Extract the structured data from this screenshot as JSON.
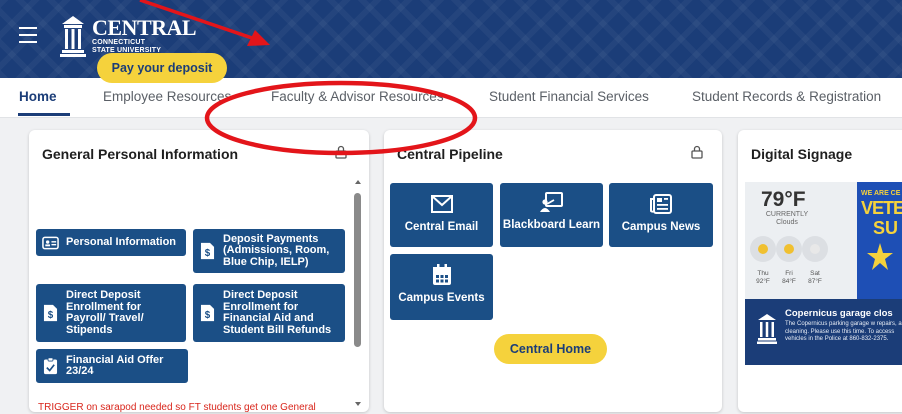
{
  "header": {
    "logo_title": "CENTRAL",
    "logo_line1": "CONNECTICUT",
    "logo_line2": "STATE UNIVERSITY"
  },
  "nav": {
    "tabs": [
      {
        "label": "Home",
        "active": true
      },
      {
        "label": "Employee Resources",
        "active": false
      },
      {
        "label": "Faculty & Advisor Resources",
        "active": false
      },
      {
        "label": "Student Financial Services",
        "active": false
      },
      {
        "label": "Student Records & Registration",
        "active": false
      }
    ]
  },
  "general": {
    "title": "General Personal Information",
    "pay_button": "Pay your deposit",
    "buttons": [
      {
        "label": "Personal Information",
        "icon": "id-card-icon"
      },
      {
        "label": "Deposit Payments (Admissions, Room, Blue Chip, IELP)",
        "icon": "dollar-doc-icon"
      },
      {
        "label": "Direct Deposit Enrollment for Payroll/ Travel/ Stipends",
        "icon": "dollar-doc-icon"
      },
      {
        "label": "Direct Deposit Enrollment for Financial Aid and Student Bill Refunds",
        "icon": "dollar-doc-icon"
      },
      {
        "label": "Financial Aid Offer 23/24",
        "icon": "checklist-icon"
      }
    ],
    "trigger_text": "TRIGGER on sarapod needed so FT students get one General"
  },
  "pipeline": {
    "title": "Central Pipeline",
    "buttons": [
      {
        "label": "Central Email",
        "icon": "envelope-icon"
      },
      {
        "label": "Blackboard Learn",
        "icon": "presentation-icon"
      },
      {
        "label": "Campus News",
        "icon": "newspaper-icon"
      },
      {
        "label": "Campus Events",
        "icon": "calendar-icon"
      }
    ],
    "home_button": "Central Home"
  },
  "signage": {
    "title": "Digital Signage",
    "temp": "79°F",
    "current": "CURRENTLY",
    "conditions": "Clouds",
    "forecast": [
      {
        "day": "Thu",
        "temp": "92°F"
      },
      {
        "day": "Fri",
        "temp": "84°F"
      },
      {
        "day": "Sat",
        "temp": "87°F"
      }
    ],
    "vet_small": "WE ARE CE",
    "vet_big": "VETE",
    "vet_big2": "SU",
    "notice_title": "Copernicus garage clos",
    "notice_text": "The Copernicus parking garage w repairs, and cleaning. Please use this time. To access vehicles in the Police at 860-832-2375."
  },
  "colors": {
    "header_bg": "#1b3d78",
    "button_blue": "#1b4f86",
    "accent_yellow": "#f5d23c",
    "annotation_red": "#e3151a"
  }
}
